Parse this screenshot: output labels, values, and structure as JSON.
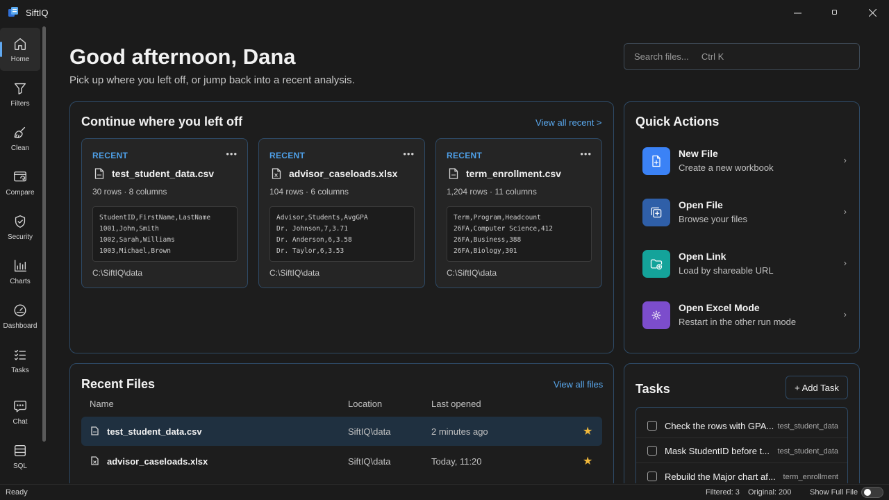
{
  "app": {
    "title": "SiftIQ"
  },
  "sidebar": {
    "items": [
      {
        "label": "Home",
        "icon": "home-icon"
      },
      {
        "label": "Filters",
        "icon": "filter-icon"
      },
      {
        "label": "Clean",
        "icon": "broom-icon"
      },
      {
        "label": "Compare",
        "icon": "compare-icon"
      },
      {
        "label": "Security",
        "icon": "shield-icon"
      },
      {
        "label": "Charts",
        "icon": "bar-chart-icon"
      },
      {
        "label": "Dashboard",
        "icon": "gauge-icon"
      },
      {
        "label": "Tasks",
        "icon": "checklist-icon"
      },
      {
        "label": "Chat",
        "icon": "chat-icon"
      },
      {
        "label": "SQL",
        "icon": "database-icon"
      }
    ]
  },
  "header": {
    "greeting": "Good afternoon, Dana",
    "subtitle": "Pick up where you left off, or jump back into a recent analysis.",
    "search_placeholder": "Search files...     Ctrl K"
  },
  "continue": {
    "title": "Continue where you left off",
    "view_all": "View all recent >",
    "cards": [
      {
        "tag": "RECENT",
        "name": "test_student_data.csv",
        "meta": "30 rows · 8 columns",
        "preview": [
          "StudentID,FirstName,LastName",
          "1001,John,Smith",
          "1002,Sarah,Williams",
          "1003,Michael,Brown"
        ],
        "path": "C:\\SiftIQ\\data"
      },
      {
        "tag": "RECENT",
        "name": "advisor_caseloads.xlsx",
        "meta": "104 rows · 6 columns",
        "preview": [
          "Advisor,Students,AvgGPA",
          "Dr. Johnson,7,3.71",
          "Dr. Anderson,6,3.58",
          "Dr. Taylor,6,3.53"
        ],
        "path": "C:\\SiftIQ\\data"
      },
      {
        "tag": "RECENT",
        "name": "term_enrollment.csv",
        "meta": "1,204 rows · 11 columns",
        "preview": [
          "Term,Program,Headcount",
          "26FA,Computer Science,412",
          "26FA,Business,388",
          "26FA,Biology,301"
        ],
        "path": "C:\\SiftIQ\\data"
      }
    ]
  },
  "quick_actions": {
    "title": "Quick Actions",
    "items": [
      {
        "title": "New File",
        "desc": "Create a new workbook",
        "color": "#3b82f6",
        "icon": "new-file-icon"
      },
      {
        "title": "Open File",
        "desc": "Browse your files",
        "color": "#2f5fa8",
        "icon": "open-file-icon"
      },
      {
        "title": "Open Link",
        "desc": "Load by shareable URL",
        "color": "#14a39a",
        "icon": "open-link-icon"
      },
      {
        "title": "Open Excel Mode",
        "desc": "Restart in the other run mode",
        "color": "#7c4dcc",
        "icon": "gear-icon"
      }
    ]
  },
  "recent_files": {
    "title": "Recent Files",
    "view_all": "View all files",
    "columns": [
      "Name",
      "Location",
      "Last opened"
    ],
    "rows": [
      {
        "name": "test_student_data.csv",
        "location": "SiftIQ\\data",
        "opened": "2 minutes ago",
        "star": "★"
      },
      {
        "name": "advisor_caseloads.xlsx",
        "location": "SiftIQ\\data",
        "opened": "Today, 11:20",
        "star": "★"
      }
    ]
  },
  "tasks": {
    "title": "Tasks",
    "add_label": "+ Add Task",
    "items": [
      {
        "text": "Check the rows with GPA...",
        "tag": "test_student_data"
      },
      {
        "text": "Mask StudentID before t...",
        "tag": "test_student_data"
      },
      {
        "text": "Rebuild the Major chart af...",
        "tag": "term_enrollment"
      }
    ]
  },
  "status": {
    "ready": "Ready",
    "filtered": "Filtered: 3",
    "original": "Original: 200",
    "full_file": "Show Full File"
  }
}
